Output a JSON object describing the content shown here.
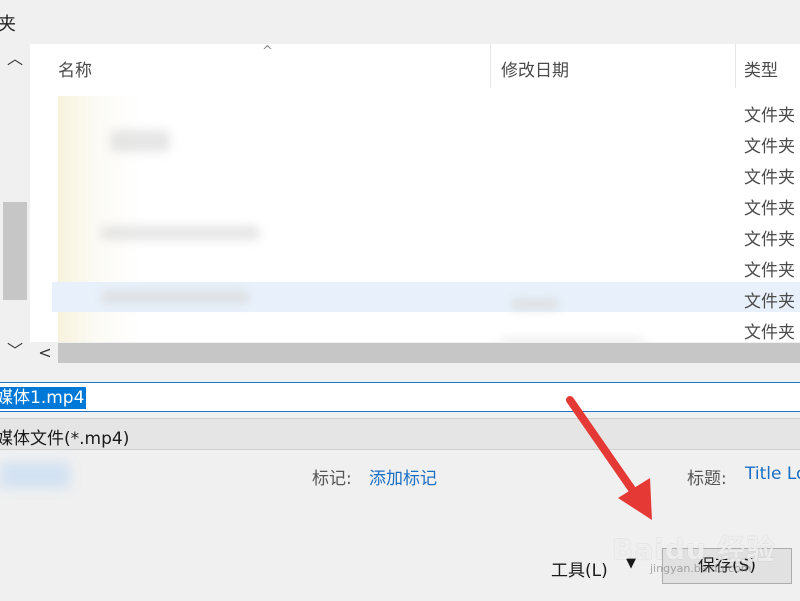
{
  "window": {
    "title_fragment": "夹"
  },
  "file_list": {
    "columns": [
      {
        "label": "名称",
        "sorted": true
      },
      {
        "label": "修改日期"
      },
      {
        "label": "类型"
      }
    ],
    "rows": [
      {
        "type": "文件夹"
      },
      {
        "type": "文件夹"
      },
      {
        "type": "文件夹"
      },
      {
        "type": "文件夹"
      },
      {
        "type": "文件夹"
      },
      {
        "type": "文件夹"
      },
      {
        "type": "文件夹",
        "selected": true
      },
      {
        "type": "文件夹"
      }
    ]
  },
  "fields": {
    "filename_value": "媒体1.mp4",
    "filetype_value": "媒体文件(*.mp4)"
  },
  "metadata": {
    "tags_label": "标记:",
    "tags_link": "添加标记",
    "title_label": "标题:",
    "title_link": "Title Lo"
  },
  "buttons": {
    "tools_label": "工具(L)",
    "save_label": "保存(S)"
  },
  "watermark": {
    "text": "Baidu 经验",
    "subtext": "jingyan.baidu.com"
  },
  "icons": {
    "scroll_up": "chevron-up-icon",
    "scroll_down": "chevron-down-icon",
    "scroll_left": "chevron-left-icon",
    "sort_indicator": "sort-ascending-icon",
    "dropdown": "caret-down-icon",
    "annotation": "red-arrow-icon"
  },
  "colors": {
    "accent": "#0078d7",
    "link": "#1a6fc4",
    "annotation_arrow": "#e53935",
    "selection_row": "#e8f1fb"
  }
}
